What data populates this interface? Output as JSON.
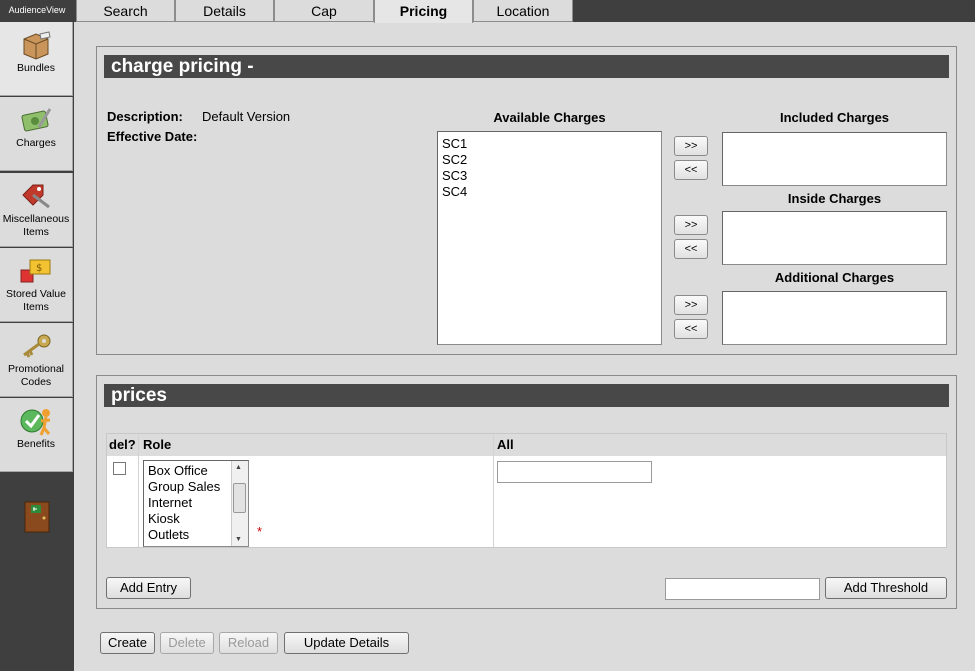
{
  "app": {
    "brand": "AudienceView"
  },
  "sidebar": {
    "items": [
      {
        "label": "Bundles",
        "icon": "bundles-icon"
      },
      {
        "label": "Charges",
        "icon": "charges-icon"
      },
      {
        "label": "Miscellaneous Items",
        "icon": "misc-items-icon"
      },
      {
        "label": "Stored Value Items",
        "icon": "stored-value-icon"
      },
      {
        "label": "Promotional Codes",
        "icon": "key-icon"
      },
      {
        "label": "Benefits",
        "icon": "benefits-icon"
      }
    ],
    "exit_icon": "exit-door-icon"
  },
  "tabs": [
    {
      "label": "Search"
    },
    {
      "label": "Details"
    },
    {
      "label": "Cap"
    },
    {
      "label": "Pricing",
      "active": true
    },
    {
      "label": "Location"
    }
  ],
  "charge_pricing": {
    "title": "charge pricing -",
    "description_label": "Description:",
    "description_value": "Default Version",
    "effective_date_label": "Effective Date:",
    "available_label": "Available Charges",
    "available": [
      "SC1",
      "SC2",
      "SC3",
      "SC4"
    ],
    "included_label": "Included Charges",
    "inside_label": "Inside Charges",
    "additional_label": "Additional Charges",
    "add_label": ">>",
    "remove_label": "<<"
  },
  "prices": {
    "title": "prices",
    "columns": {
      "del": "del?",
      "role": "Role",
      "all": "All"
    },
    "roles": [
      "Box Office",
      "Group Sales",
      "Internet",
      "Kiosk",
      "Outlets"
    ],
    "required_mark": "*",
    "add_entry": "Add Entry",
    "add_threshold": "Add Threshold"
  },
  "footer": {
    "create": "Create",
    "delete": "Delete",
    "reload": "Reload",
    "update_details": "Update Details"
  },
  "colors": {
    "dark": "#3f3f3f",
    "header_bar": "#484848",
    "background": "#dcdcdc",
    "required": "#cc0000"
  }
}
